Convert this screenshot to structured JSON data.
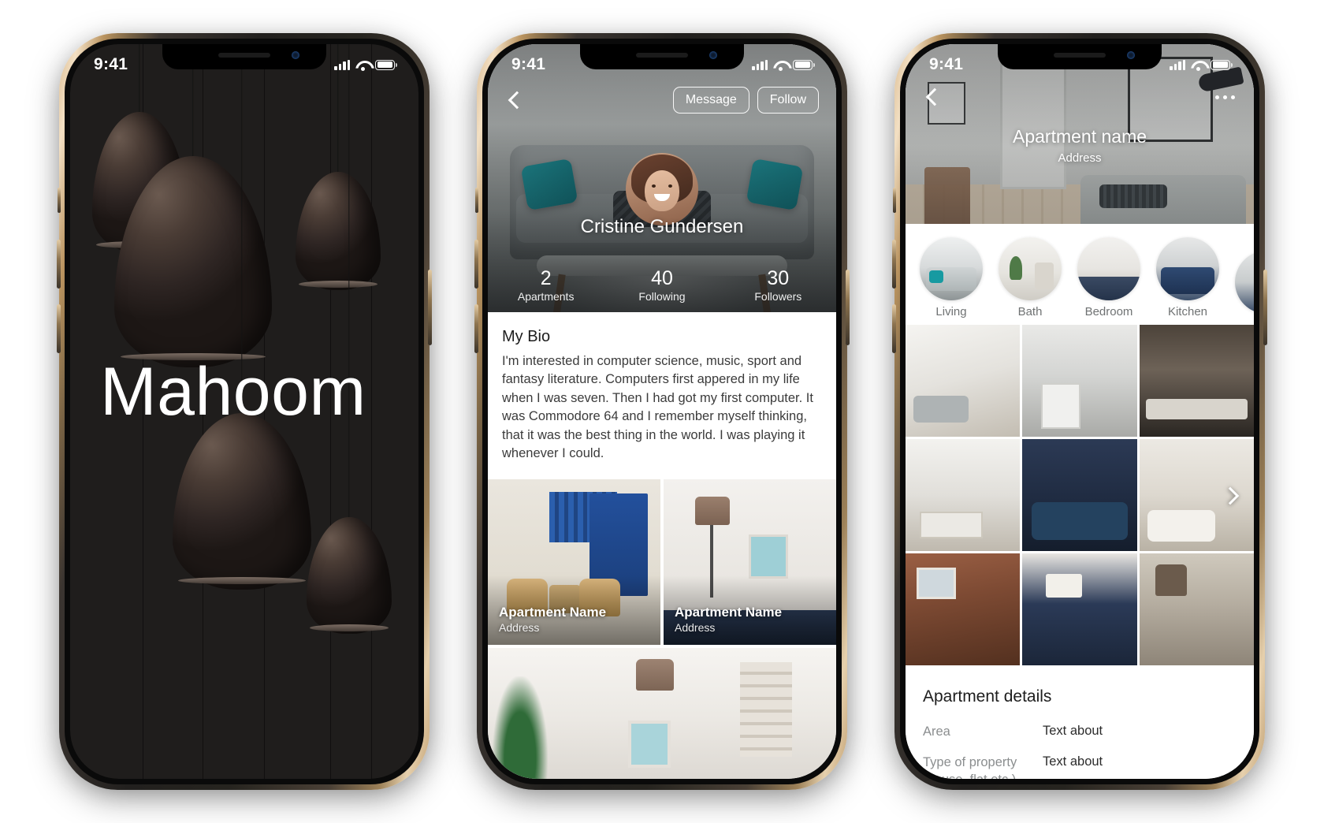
{
  "status_bar": {
    "time": "9:41",
    "signal_icon": "cellular-signal-icon",
    "wifi_icon": "wifi-icon",
    "battery_icon": "battery-icon"
  },
  "screen1": {
    "name": "splash-screen",
    "brand_title": "Mahoom",
    "background_color": "#1f1d1c"
  },
  "screen2": {
    "name": "profile-screen",
    "back_icon": "back-chevron-icon",
    "actions": {
      "message_label": "Message",
      "follow_label": "Follow"
    },
    "profile_name": "Cristine Gundersen",
    "stats": [
      {
        "value": "2",
        "label": "Apartments"
      },
      {
        "value": "40",
        "label": "Following"
      },
      {
        "value": "30",
        "label": "Followers"
      }
    ],
    "bio": {
      "title": "My Bio",
      "text": "I'm interested in computer science, music, sport and fantasy literature. Computers first appered in my life when I was seven. Then I had got my first computer. It was Commodore 64 and I remember myself thinking, that it was the best thing in the world. I was playing it whenever I could."
    },
    "apartments": [
      {
        "name": "Apartment Name",
        "address": "Address"
      },
      {
        "name": "Apartment Name",
        "address": "Address"
      }
    ]
  },
  "screen3": {
    "name": "apartment-screen",
    "back_icon": "back-chevron-icon",
    "menu_icon": "more-options-icon",
    "title": "Apartment name",
    "address": "Address",
    "categories": [
      {
        "label": "Living",
        "thumb": "thumb-living"
      },
      {
        "label": "Bath",
        "thumb": "thumb-bath"
      },
      {
        "label": "Bedroom",
        "thumb": "thumb-bedroom"
      },
      {
        "label": "Kitchen",
        "thumb": "thumb-kitchen"
      },
      {
        "label": "",
        "thumb": "thumb-more"
      }
    ],
    "next_icon": "next-chevron-icon",
    "details": {
      "title": "Apartment details",
      "rows": [
        {
          "key": "Area",
          "key_sub": "",
          "value": "Text about"
        },
        {
          "key": "Type of property",
          "key_sub": "(house, flat etc.)",
          "value": "Text about"
        }
      ]
    }
  }
}
